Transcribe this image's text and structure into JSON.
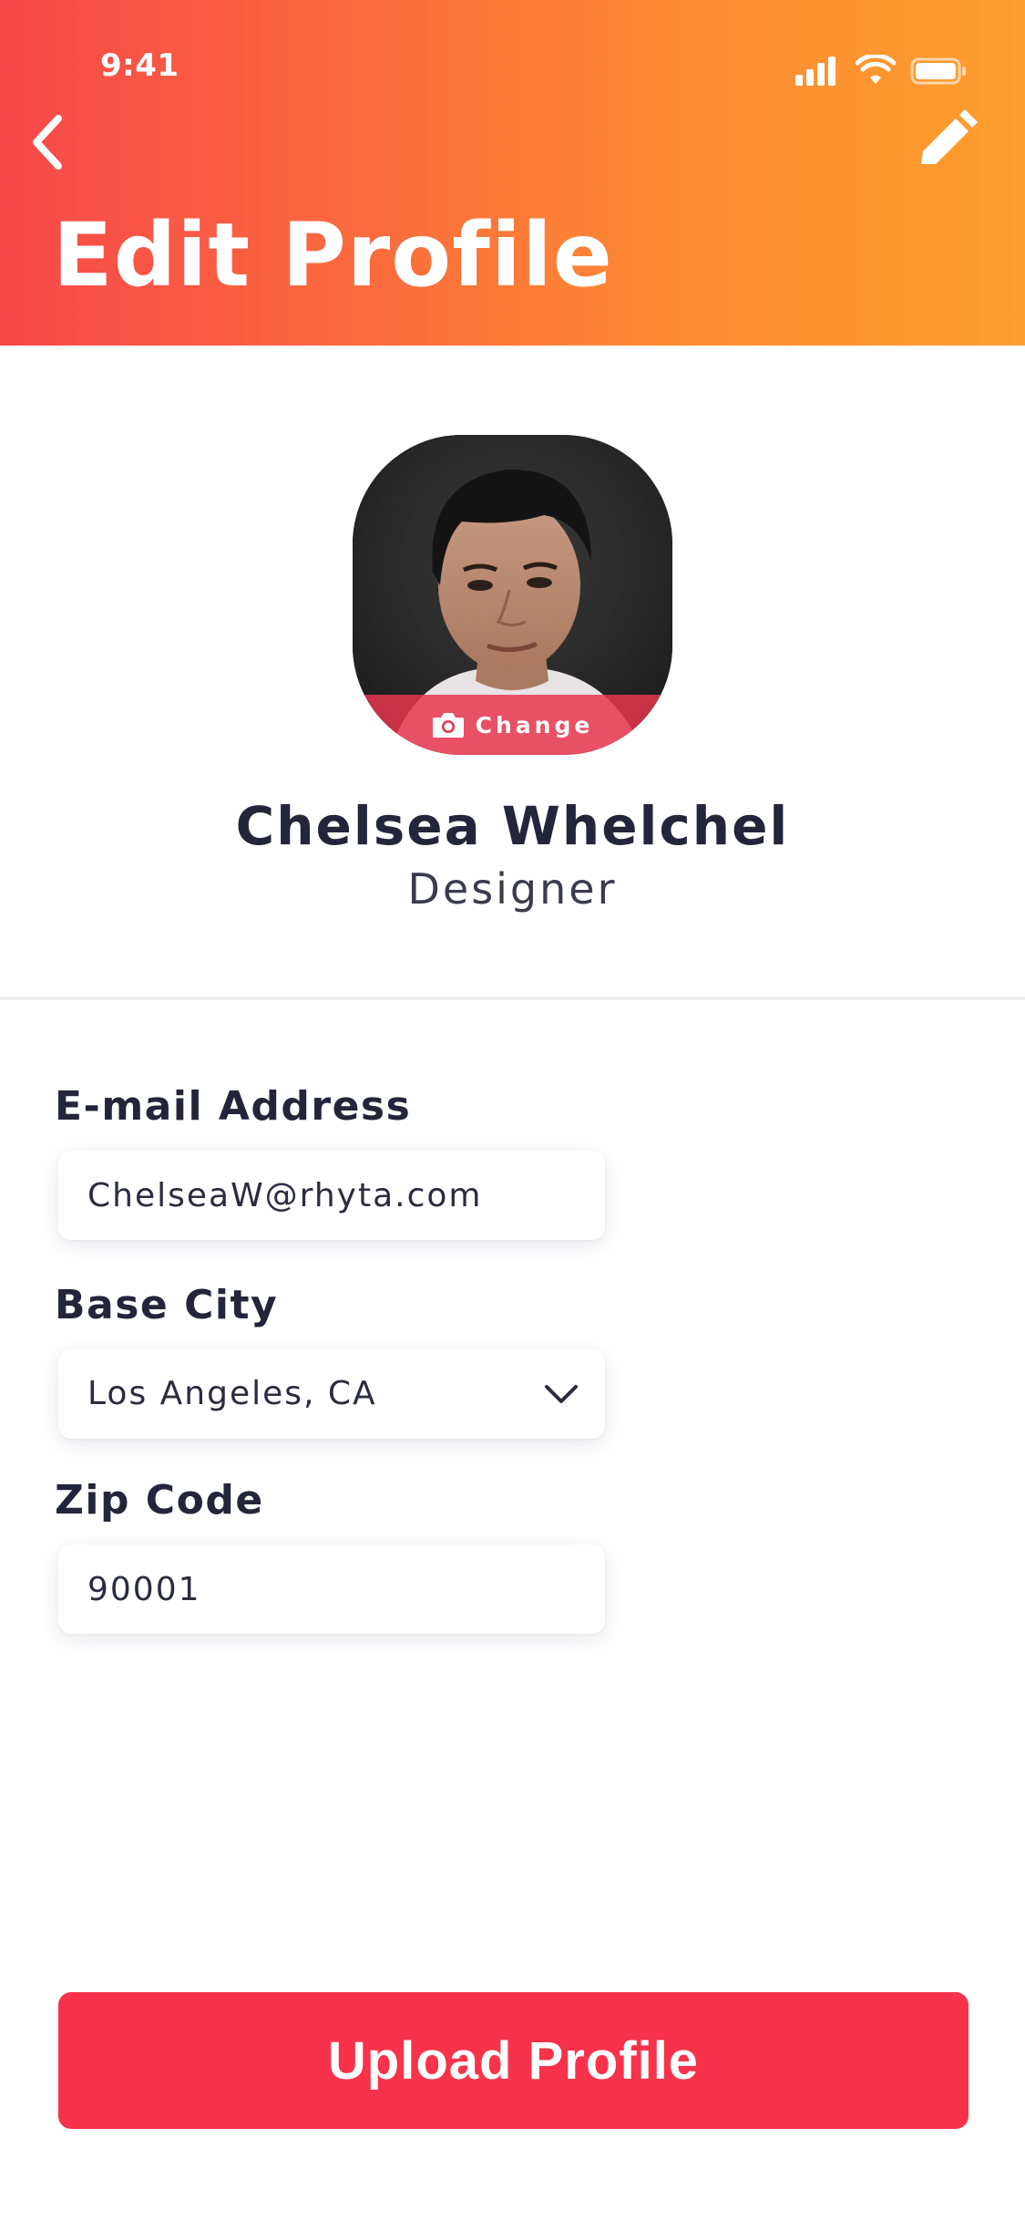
{
  "status_bar": {
    "time": "9:41"
  },
  "header": {
    "title": "Edit Profile"
  },
  "profile": {
    "change_label": "Change",
    "name": "Chelsea Whelchel",
    "role": "Designer"
  },
  "form": {
    "email": {
      "label": "E-mail Address",
      "value": "ChelseaW@rhyta.com"
    },
    "city": {
      "label": "Base City",
      "value": "Los Angeles, CA"
    },
    "zip": {
      "label": "Zip Code",
      "value": "90001"
    }
  },
  "actions": {
    "upload_label": "Upload Profile"
  },
  "colors": {
    "header_gradient_start": "#f7474a",
    "header_gradient_end": "#fe9e2d",
    "accent": "#f7324a",
    "text_dark": "#23253a"
  },
  "icons": [
    "signal-icon",
    "wifi-icon",
    "battery-icon",
    "back-chevron-icon",
    "pencil-icon",
    "camera-icon",
    "chevron-down-icon"
  ]
}
